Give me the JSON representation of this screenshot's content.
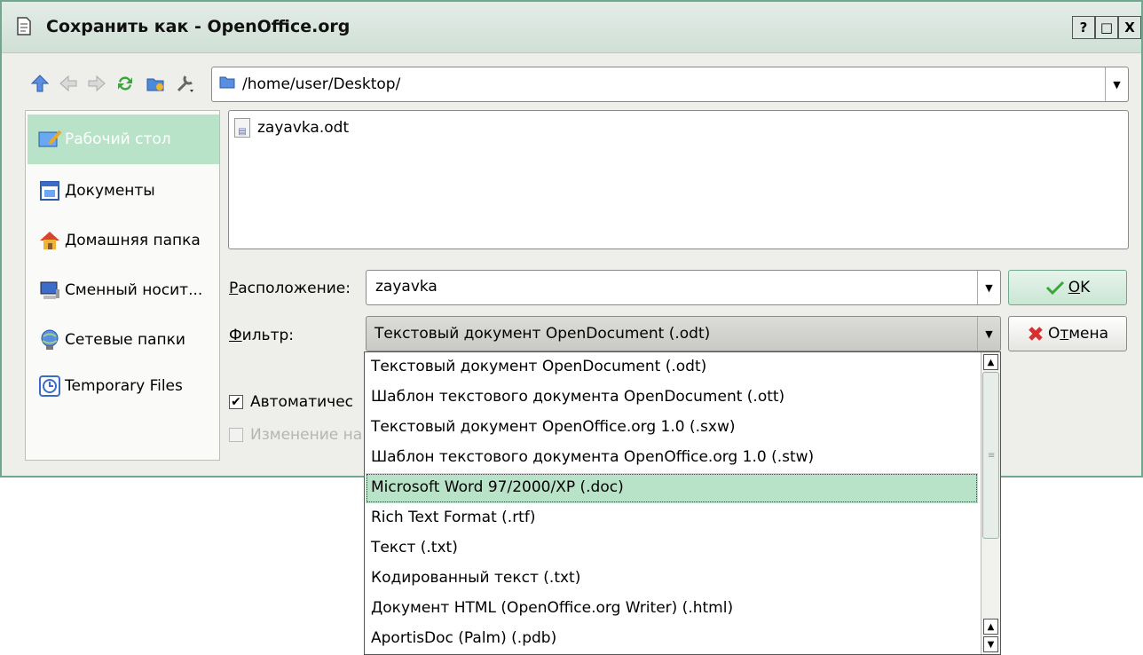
{
  "window": {
    "title": "Сохранить как - OpenOffice.org",
    "buttons": {
      "help": "?",
      "maximize": "□",
      "close": "X"
    }
  },
  "toolbar": {
    "icons": [
      "up-icon",
      "back-icon",
      "forward-icon",
      "reload-icon",
      "new-folder-icon",
      "settings-icon"
    ],
    "path": "/home/user/Desktop/"
  },
  "sidebar": {
    "items": [
      {
        "label": "Рабочий стол",
        "icon": "desktop-icon",
        "selected": true
      },
      {
        "label": "Документы",
        "icon": "documents-icon"
      },
      {
        "label": "Домашняя папка",
        "icon": "home-icon"
      },
      {
        "label": "Сменный носит...",
        "icon": "removable-media-icon"
      },
      {
        "label": "Сетевые папки",
        "icon": "network-icon"
      },
      {
        "label": "Temporary Files",
        "icon": "temp-files-icon"
      }
    ]
  },
  "files": [
    {
      "name": "zayavka.odt"
    }
  ],
  "location": {
    "label_pre": "",
    "label_u": "Р",
    "label_post": "асположение:",
    "value": "zayavka"
  },
  "filter": {
    "label_u": "Ф",
    "label_post": "ильтр:",
    "value": "Текстовый документ OpenDocument (.odt)"
  },
  "buttons": {
    "ok_u": "O",
    "ok_post": "K",
    "cancel_pre": "О",
    "cancel_u": "т",
    "cancel_post": "мена"
  },
  "options": {
    "auto_ext": {
      "label": "Автоматичес",
      "checked": true
    },
    "edit_filter": {
      "label": "Изменение на",
      "checked": false,
      "disabled": true
    }
  },
  "filter_options": [
    "Текстовый документ OpenDocument (.odt)",
    "Шаблон текстового документа OpenDocument (.ott)",
    "Текстовый документ OpenOffice.org 1.0 (.sxw)",
    "Шаблон текстового документа OpenOffice.org 1.0 (.stw)",
    "Microsoft Word 97/2000/XP (.doc)",
    "Rich Text Format (.rtf)",
    "Текст (.txt)",
    "Кодированный текст (.txt)",
    "Документ HTML (OpenOffice.org Writer) (.html)",
    "AportisDoc (Palm) (.pdb)"
  ],
  "highlighted_option": 4,
  "colors": {
    "accent": "#b9e3c9",
    "frame": "#6fa88c",
    "background": "#eeeeea"
  }
}
